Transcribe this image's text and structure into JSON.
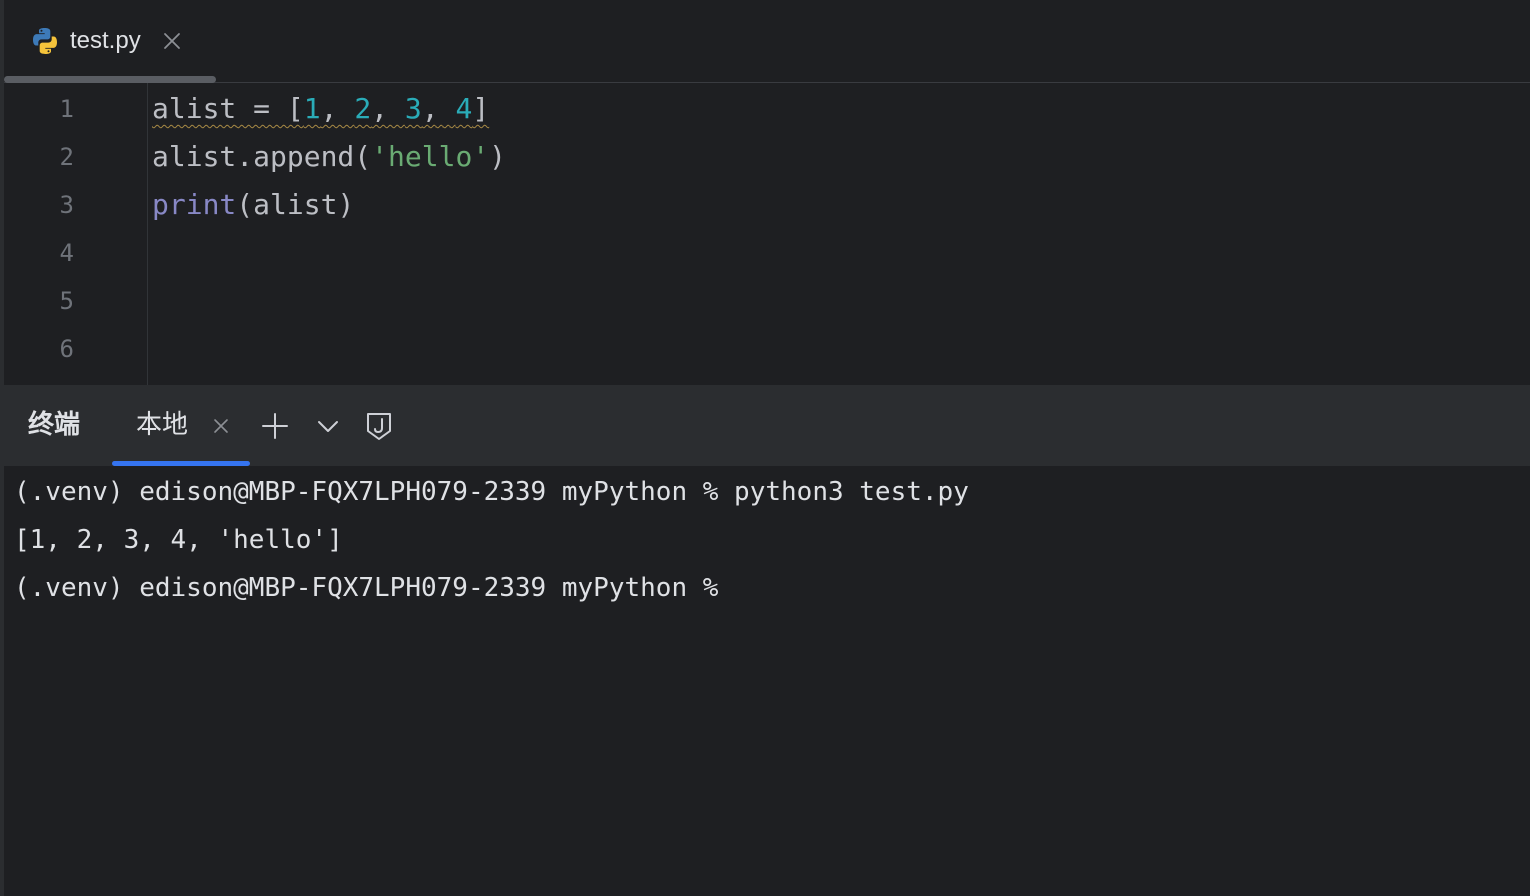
{
  "editor_tabs": [
    {
      "label": "test.py",
      "icon": "python-icon",
      "active": true
    }
  ],
  "editor": {
    "line_numbers": [
      "1",
      "2",
      "3",
      "4",
      "5",
      "6"
    ],
    "lines": [
      [
        {
          "t": "alist",
          "k": "default",
          "sq": true
        },
        {
          "t": " = [",
          "k": "default",
          "sq": true
        },
        {
          "t": "1",
          "k": "num",
          "sq": true
        },
        {
          "t": ", ",
          "k": "default",
          "sq": true
        },
        {
          "t": "2",
          "k": "num",
          "sq": true
        },
        {
          "t": ", ",
          "k": "default",
          "sq": true
        },
        {
          "t": "3",
          "k": "num",
          "sq": true
        },
        {
          "t": ", ",
          "k": "default",
          "sq": true
        },
        {
          "t": "4",
          "k": "num",
          "sq": true
        },
        {
          "t": "]",
          "k": "default",
          "sq": true
        }
      ],
      [
        {
          "t": "alist.append(",
          "k": "default"
        },
        {
          "t": "'hello'",
          "k": "str"
        },
        {
          "t": ")",
          "k": "default"
        }
      ],
      [
        {
          "t": "print",
          "k": "builtin"
        },
        {
          "t": "(alist)",
          "k": "default"
        }
      ],
      [],
      [],
      []
    ]
  },
  "terminal": {
    "title": "终端",
    "tabs": [
      {
        "label": "本地",
        "active": true
      }
    ],
    "lines": [
      "(.venv) edison@MBP-FQX7LPH079-2339 myPython % python3 test.py",
      "[1, 2, 3, 4, 'hello']",
      "(.venv) edison@MBP-FQX7LPH079-2339 myPython %"
    ]
  },
  "colors": {
    "background": "#1e1f22",
    "panel_header": "#2b2d30",
    "accent": "#3574f0",
    "number": "#2aacb8",
    "string": "#6aab73",
    "builtin": "#8888c6",
    "text": "#bcbec4"
  }
}
